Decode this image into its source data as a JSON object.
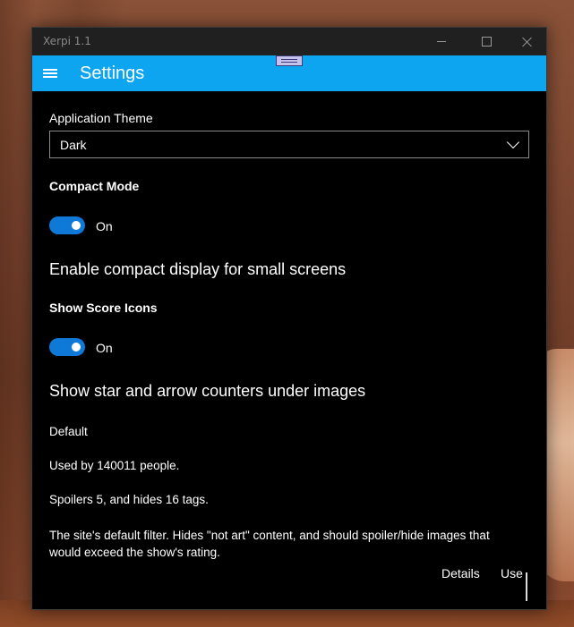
{
  "window": {
    "title": "Xerpi 1.1",
    "accent_color": "#0ea5f0"
  },
  "header": {
    "menu_icon": "hamburger-icon",
    "title": "Settings"
  },
  "settings": {
    "theme_label": "Application Theme",
    "theme_value": "Dark",
    "compact_label": "Compact Mode",
    "compact_state": "On",
    "compact_desc": "Enable compact display for small screens",
    "score_label": "Show Score Icons",
    "score_state": "On",
    "score_desc": "Show star and arrow counters under images"
  },
  "filter": {
    "name": "Default",
    "users": "Used by 140011 people.",
    "spoilers": "Spoilers 5, and hides 16 tags.",
    "description": "The site's default filter. Hides \"not art\" content, and should spoiler/hide images that would exceed the show's rating.",
    "details_label": "Details",
    "use_label": "Use"
  }
}
